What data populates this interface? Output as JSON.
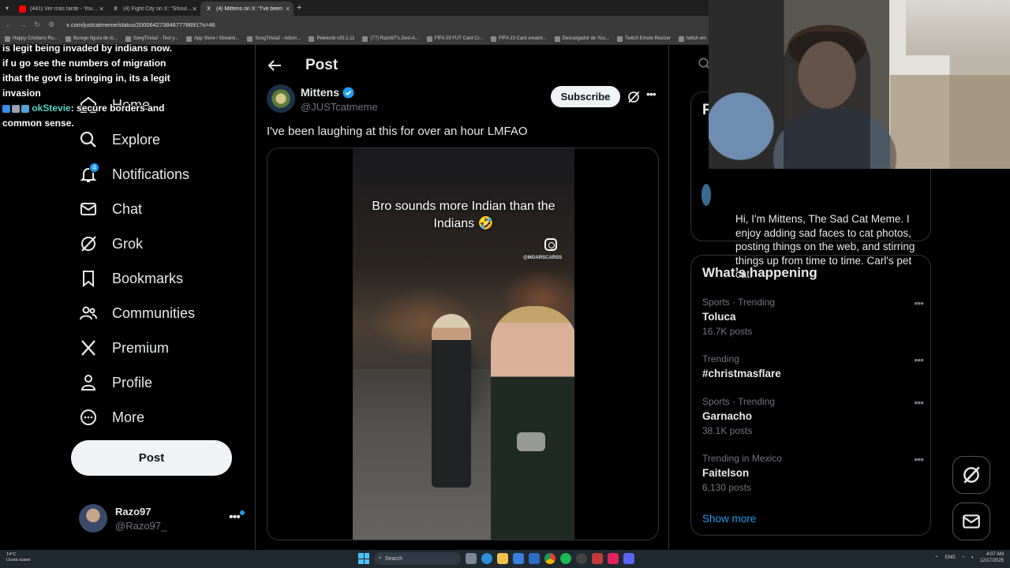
{
  "browser": {
    "tabs": [
      {
        "title": "(441) Ver más tarde - YouTube",
        "color": "#ff0000",
        "active": false
      },
      {
        "title": "(4) Fight City on X: \"Should leg",
        "color": "#000000",
        "active": false
      },
      {
        "title": "(4) Mittens on X: \"I've been",
        "color": "#000000",
        "active": true
      }
    ],
    "tab_icon_x": "X",
    "url": "x.com/justcatmeme/status/2000642738467778691?s=46",
    "bookmarks": [
      "Happy Cristiano Ro...",
      "Burego figura de lo...",
      "SongTrivia2 - Test y...",
      "App Store / Streami...",
      "SongTrivia2 - Adivin...",
      "Peletoob v25.1.11",
      "(77) Razo97's Zest-A...",
      "FIFA 23 FUT Card Cr...",
      "FIFA 23 Card creator...",
      "Descargador de You...",
      "Twitch Emote Resizer",
      "twitch em"
    ]
  },
  "chat_overlay": {
    "message1": "is legit being invaded by indians now. if u go see the numbers of migration ithat the govt is bringing in, its a legit invasion",
    "username": "okStevie",
    "message2": ": secure borders and common sense."
  },
  "nav": {
    "items": [
      {
        "label": "Home",
        "icon": "home-icon"
      },
      {
        "label": "Explore",
        "icon": "search-icon"
      },
      {
        "label": "Notifications",
        "icon": "bell-icon",
        "badge": "4"
      },
      {
        "label": "Chat",
        "icon": "mail-icon"
      },
      {
        "label": "Grok",
        "icon": "grok-icon"
      },
      {
        "label": "Bookmarks",
        "icon": "bookmark-icon"
      },
      {
        "label": "Communities",
        "icon": "communities-icon"
      },
      {
        "label": "Premium",
        "icon": "x-logo-icon"
      },
      {
        "label": "Profile",
        "icon": "person-icon"
      },
      {
        "label": "More",
        "icon": "more-circle-icon"
      }
    ],
    "post_label": "Post",
    "account": {
      "name": "Razo97",
      "handle": "@Razo97_",
      "more": "•••"
    }
  },
  "main": {
    "title": "Post",
    "author_name": "Mittens",
    "author_handle": "@JUSTcatmeme",
    "subscribe_label": "Subscribe",
    "more": "•••",
    "post_text": "I've been laughing at this for over an hour LMFAO",
    "video_caption": "Bro sounds more Indian than the Indians 🤣",
    "video_watermark": "@MOARSCARSS"
  },
  "right": {
    "bio_card_title": "R",
    "bio_text": "Hi, I'm Mittens, The Sad Cat Meme. I enjoy adding sad faces to cat photos, posting things on the web, and stirring things up from time to time. Carl's pet cat.",
    "trends_title": "What’s happening",
    "trends": [
      {
        "context": "Sports · Trending",
        "name": "Toluca",
        "count": "16.7K posts"
      },
      {
        "context": "Trending",
        "name": "#christmasflare",
        "count": ""
      },
      {
        "context": "Sports · Trending",
        "name": "Garnacho",
        "count": "38.1K posts"
      },
      {
        "context": "Trending in Mexico",
        "name": "Faitelson",
        "count": "6,130 posts"
      }
    ],
    "trend_more": "•••",
    "show_more": "Show more"
  },
  "taskbar": {
    "weather_temp": "14°C",
    "weather_desc": "Lluvia suave",
    "search_label": "Search",
    "lang": "ENG",
    "time": "4:07 AM",
    "date": "12/17/2025"
  },
  "colors": {
    "accent": "#1d9bf0",
    "background": "#000000",
    "border": "#2f3336",
    "muted": "#71767b"
  }
}
